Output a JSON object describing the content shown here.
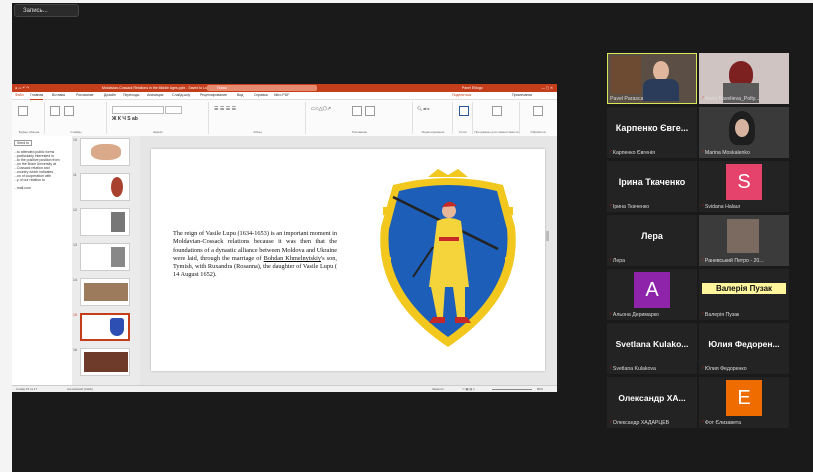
{
  "recording": {
    "label": "Запись..."
  },
  "powerpoint": {
    "window_title": "Moldavian-Cossack Relations in the Middle Ages.pptx - Saved to Local PC",
    "search_placeholder": "Поиск",
    "user": "Pavel Ehlogu",
    "tabs": [
      "Файл",
      "Главная",
      "Вставка",
      "Рисование",
      "Дизайн",
      "Переходы",
      "Анимация",
      "Слайд-шоу",
      "Рецензирование",
      "Вид",
      "Справка",
      "Nitro PDF"
    ],
    "tabs_right": [
      "Поделиться",
      "Примечания"
    ],
    "ribbon_groups": [
      "Буфер обмена",
      "Слайды",
      "Шрифт",
      "Абзац",
      "Рисование",
      "Редактирование",
      "Голос",
      "Программы для совместимости",
      "Обработка"
    ],
    "slide_numbers": [
      "10",
      "11",
      "12",
      "13",
      "14",
      "15",
      "16"
    ],
    "selected_slide": "15",
    "slide_text_a": "The reign of Vasile Lupu (1634-1653) is an important moment in Moldavian-Cossack relations because it was then that the foundations of a dynastic alliance between Moldova and Ukraine were laid, through the marriage of ",
    "slide_text_link": "Bohdan Khmelnytskiy",
    "slide_text_b": "'s son, Tymish, with Ruxandra (Rosanna), the daughter of Vasile Lupu ( 14 August 1652).",
    "status_left": "Слайд 15 из 17",
    "status_lang": "Английский (США)",
    "status_notes": "Заметки",
    "zoom": "80%",
    "notes_pane_lines": [
      "Send to",
      "...to attended public forms",
      "...particularly interested in",
      "...to the positive position from",
      "...on the Brain University at",
      "...Cossack relation and",
      "...country which indicates",
      "...on of cooperation with",
      "...y of our relation to",
      "...mail.com"
    ]
  },
  "participants": [
    {
      "name_large": "",
      "label": "Pavel Parasca",
      "video": true,
      "active": true,
      "muted": false
    },
    {
      "name_large": "",
      "label": "Anna Pavelieva_Polty...",
      "video": true,
      "muted": true
    },
    {
      "name_large": "Карпенко Євге...",
      "label": "Карпенко Євгенія",
      "muted": true
    },
    {
      "name_large": "",
      "label": "Marina Moskalenko",
      "video": true,
      "muted": true
    },
    {
      "name_large": "Ірина Ткаченко",
      "label": "Ірина Ткаченко",
      "muted": true
    },
    {
      "name_large": "",
      "label": "Svidana Halaur",
      "avatar": "S",
      "avatar_color": "#e5426c",
      "muted": true
    },
    {
      "name_large": "Лера",
      "label": "Лера",
      "muted": true
    },
    {
      "name_large": "",
      "label": "Раневський Петро - 20...",
      "video": true,
      "muted": true
    },
    {
      "name_large": "",
      "label": "Альона Деримарко",
      "avatar": "A",
      "avatar_color": "#8e24aa",
      "muted": true
    },
    {
      "name_large": "Валерія Пузак",
      "label": "Валерія Пузак",
      "name_badge": true,
      "muted": true
    },
    {
      "name_large": "Svetlana Kulako...",
      "label": "Svetlana Kulakova",
      "muted": true
    },
    {
      "name_large": "Юлия Федорен...",
      "label": "Юлия Федоренко",
      "muted": true
    },
    {
      "name_large": "Олександр ХА...",
      "label": "Олександр ХАДАРЦЕВ",
      "muted": true
    },
    {
      "name_large": "",
      "label": "Фот Єлизавета",
      "avatar": "E",
      "avatar_color": "#ef6c00",
      "muted": true
    }
  ]
}
